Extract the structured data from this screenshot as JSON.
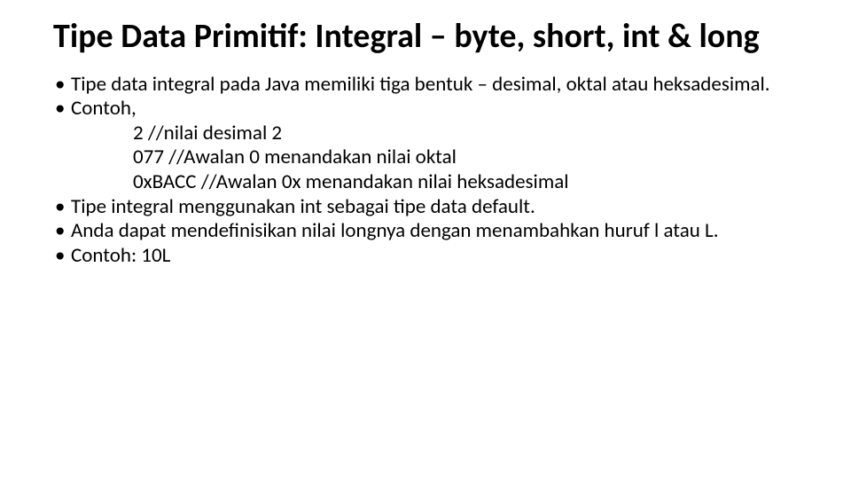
{
  "title": "Tipe Data Primitif: Integral – byte, short, int & long",
  "bullets": {
    "b1": "Tipe data integral pada Java memiliki tiga bentuk – desimal, oktal atau heksadesimal.",
    "b2": "Contoh,",
    "i1": "2  //nilai desimal 2",
    "i2": "077 //Awalan 0 menandakan nilai oktal",
    "i3": "0xBACC //Awalan 0x menandakan nilai heksadesimal",
    "b3": "Tipe integral menggunakan int sebagai tipe data default.",
    "b4": "Anda dapat mendefinisikan nilai longnya dengan menambahkan huruf l atau L.",
    "b5": "Contoh: 10L"
  }
}
